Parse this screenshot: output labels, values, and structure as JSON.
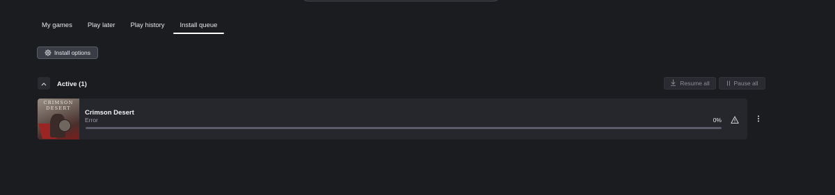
{
  "tabs": [
    {
      "label": "My games",
      "active": false
    },
    {
      "label": "Play later",
      "active": false
    },
    {
      "label": "Play history",
      "active": false
    },
    {
      "label": "Install queue",
      "active": true
    }
  ],
  "toolbar": {
    "install_options_label": "Install options",
    "install_options_icon": "gear-icon"
  },
  "active_section": {
    "title": "Active (1)",
    "collapse_icon": "chevron-up-icon",
    "resume_all_label": "Resume all",
    "resume_all_icon": "download-arrow-icon",
    "pause_all_label": "Pause all",
    "pause_all_icon": "pause-icon",
    "items": [
      {
        "title": "Crimson Desert",
        "status": "Error",
        "progress": 0,
        "progress_label": "0%",
        "thumbnail_text": [
          "CRIMSON",
          "DESERT"
        ],
        "status_icon": "warning-icon",
        "menu_icon": "more-vertical-icon"
      }
    ]
  },
  "colors": {
    "background": "#1b1c20",
    "card": "#26272d",
    "button": "#3a3c46",
    "progress_track": "#5a5c69",
    "text": "#e8e8ea",
    "muted_text": "#9c9da5"
  }
}
